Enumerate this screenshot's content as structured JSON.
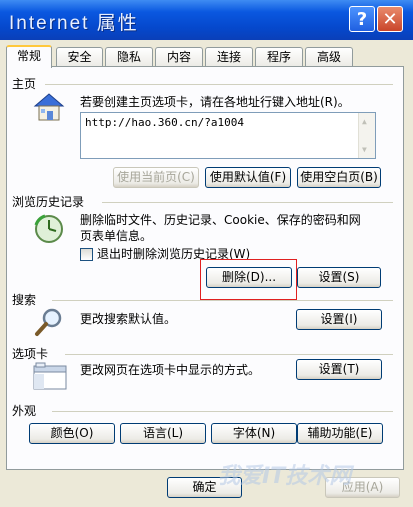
{
  "window": {
    "title": "Internet 属性",
    "help_glyph": "?",
    "close_glyph": "✕"
  },
  "tabs": [
    "常规",
    "安全",
    "隐私",
    "内容",
    "连接",
    "程序",
    "高级"
  ],
  "homepage": {
    "group_label": "主页",
    "description": "若要创建主页选项卡，请在各地址行键入地址(R)。",
    "address_value": "http://hao.360.cn/?a1004",
    "use_current": "使用当前页(C)",
    "use_default": "使用默认值(F)",
    "use_blank": "使用空白页(B)"
  },
  "history": {
    "group_label": "浏览历史记录",
    "description": "删除临时文件、历史记录、Cookie、保存的密码和网页表单信息。",
    "checkbox_label": "退出时删除浏览历史记录(W)",
    "checkbox_checked": false,
    "delete": "删除(D)...",
    "settings": "设置(S)"
  },
  "search": {
    "group_label": "搜索",
    "description": "更改搜索默认值。",
    "settings": "设置(I)"
  },
  "tabs_section": {
    "group_label": "选项卡",
    "description": "更改网页在选项卡中显示的方式。",
    "settings": "设置(T)"
  },
  "appearance": {
    "group_label": "外观",
    "colors": "颜色(O)",
    "languages": "语言(L)",
    "fonts": "字体(N)",
    "accessibility": "辅助功能(E)"
  },
  "footer": {
    "ok": "确定",
    "apply": "应用(A)"
  },
  "watermark": "我爱IT技术网",
  "colors": {
    "titlebar": "#0548cc",
    "face": "#ece9d8",
    "highlight_box": "#e02020"
  }
}
